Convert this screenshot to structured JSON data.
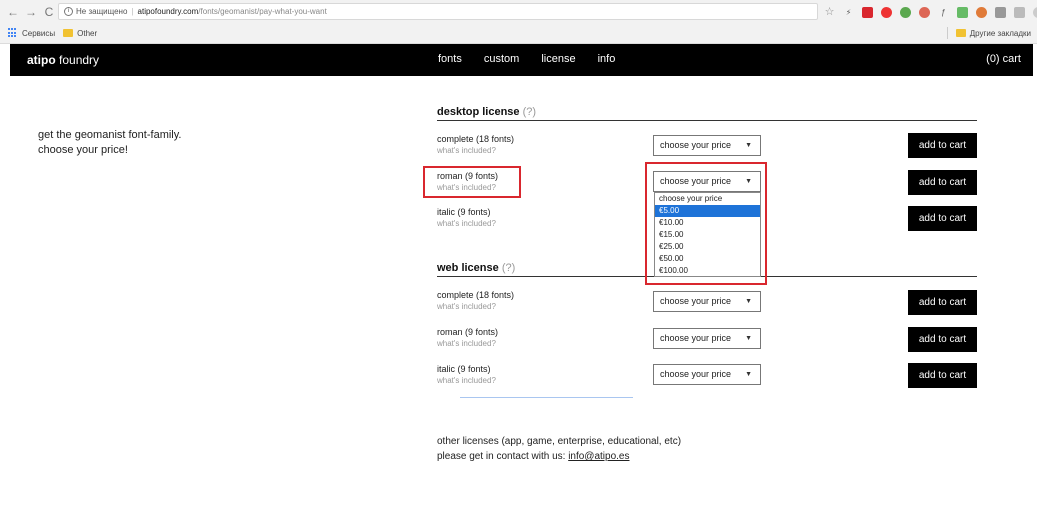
{
  "browser": {
    "security": "Не защищено",
    "host": "atipofoundry.com",
    "path": "/fonts/geomanist/pay-what-you-want",
    "bookmarks": [
      "Сервисы",
      "Other"
    ],
    "other_bookmarks": "Другие закладки"
  },
  "site": {
    "logo_bold": "atipo",
    "logo_rest": " foundry",
    "nav": [
      "fonts",
      "custom",
      "license",
      "info"
    ],
    "cart": "(0) cart"
  },
  "intro": {
    "line1": "get the geomanist font-family.",
    "line2": "choose your price!"
  },
  "desktop": {
    "title": "desktop license",
    "help": "(?)",
    "items": [
      {
        "name": "complete (18 fonts)",
        "included": "what's included?",
        "select": "choose your price",
        "button": "add to cart"
      },
      {
        "name": "roman (9 fonts)",
        "included": "what's included?",
        "select": "choose your price",
        "button": "add to cart"
      },
      {
        "name": "italic (9 fonts)",
        "included": "what's included?",
        "select": "choose your price",
        "button": "add to cart"
      }
    ]
  },
  "web": {
    "title": "web license",
    "help": "(?)",
    "items": [
      {
        "name": "complete (18 fonts)",
        "included": "what's included?",
        "select": "choose your price",
        "button": "add to cart"
      },
      {
        "name": "roman (9 fonts)",
        "included": "what's included?",
        "select": "choose your price",
        "button": "add to cart"
      },
      {
        "name": "italic (9 fonts)",
        "included": "what's included?",
        "select": "choose your price",
        "button": "add to cart"
      }
    ]
  },
  "dropdown": {
    "options": [
      "choose your price",
      "€5.00",
      "€10.00",
      "€15.00",
      "€25.00",
      "€50.00",
      "€100.00"
    ],
    "highlighted_index": 1
  },
  "other_licenses": {
    "line1": "other licenses (app, game, enterprise, educational, etc)",
    "line2_prefix": "please get in contact with us: ",
    "email": "info@atipo.es"
  },
  "colors": {
    "header_bg": "#000000",
    "highlight_box": "#d9272e",
    "option_selected": "#1e73d8"
  }
}
